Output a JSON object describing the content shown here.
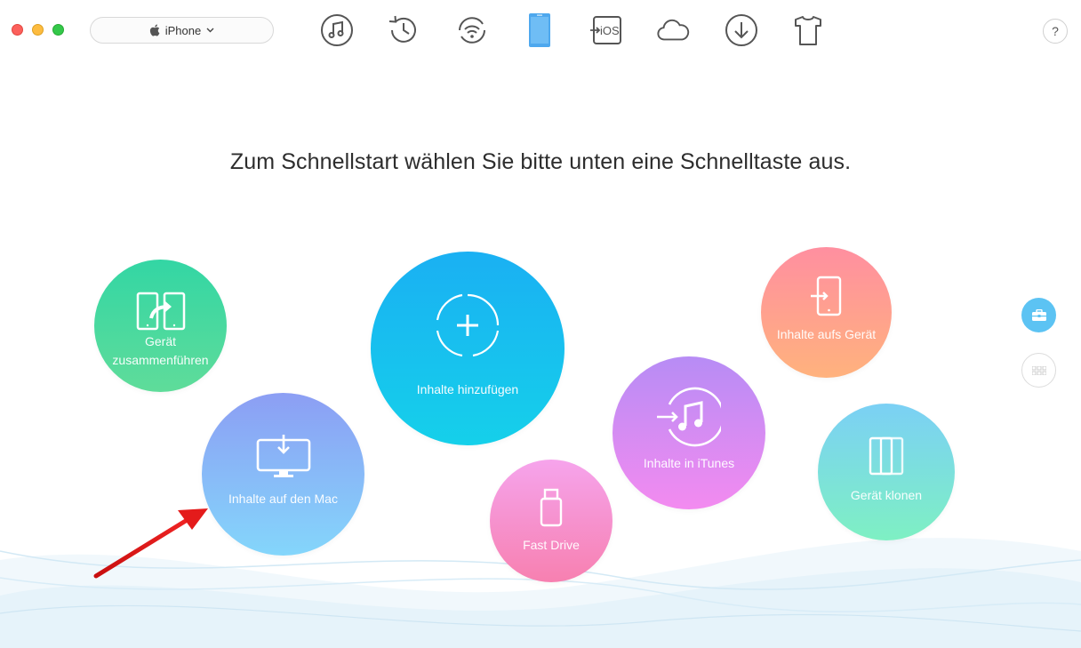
{
  "window": {
    "controls": [
      "close",
      "minimize",
      "maximize"
    ]
  },
  "device_selector": {
    "label": "iPhone",
    "icon": "apple-icon"
  },
  "toolbar": {
    "items": [
      {
        "name": "music-icon"
      },
      {
        "name": "history-icon"
      },
      {
        "name": "wifi-sync-icon"
      },
      {
        "name": "device-icon",
        "active": true
      },
      {
        "name": "ios-update-icon",
        "label": "iOS"
      },
      {
        "name": "icloud-icon"
      },
      {
        "name": "download-icon"
      },
      {
        "name": "tshirt-icon"
      }
    ],
    "help_label": "?"
  },
  "main": {
    "headline": "Zum Schnellstart wählen Sie bitte unten eine Schnelltaste aus.",
    "shortcuts": {
      "merge": "Gerät zusammenführen",
      "add": "Inhalte hinzufügen",
      "to_device": "Inhalte aufs Gerät",
      "to_mac": "Inhalte auf den Mac",
      "to_itunes": "Inhalte in iTunes",
      "fast_drive": "Fast Drive",
      "clone": "Gerät klonen"
    }
  },
  "sidebar": {
    "items": [
      {
        "name": "toolbox-icon",
        "active": true
      },
      {
        "name": "grid-icon",
        "active": false
      }
    ]
  },
  "colors": {
    "accent_blue": "#1ab0f3",
    "arrow_red": "#e11a1a",
    "merge_green": "#33d6a4",
    "device_coral": "#ff8fa0",
    "mac_lilac": "#8c9ef4",
    "itunes_violet": "#b78cf5",
    "fast_pink": "#f780b0",
    "clone_teal": "#7bd0f5"
  }
}
